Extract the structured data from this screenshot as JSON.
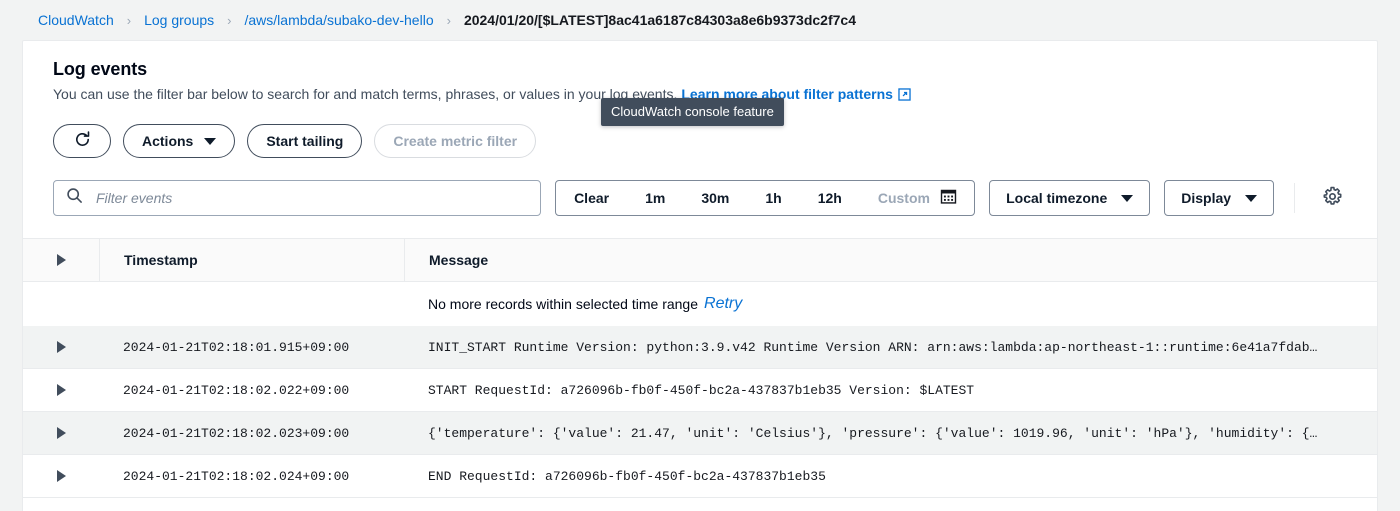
{
  "breadcrumb": {
    "items": [
      {
        "label": "CloudWatch",
        "current": false
      },
      {
        "label": "Log groups",
        "current": false
      },
      {
        "label": "/aws/lambda/subako-dev-hello",
        "current": false
      },
      {
        "label": "2024/01/20/[$LATEST]8ac41a6187c84303a8e6b9373dc2f7c4",
        "current": true
      }
    ],
    "separator": "›"
  },
  "panel": {
    "title": "Log events",
    "description": "You can use the filter bar below to search for and match terms, phrases, or values in your log events.",
    "description_link": "Learn more about filter patterns",
    "external_link_icon": "external-link-icon"
  },
  "tooltip": {
    "text": "CloudWatch console feature"
  },
  "toolbar": {
    "refresh_icon": "refresh-icon",
    "actions_label": "Actions",
    "start_tailing_label": "Start tailing",
    "create_metric_filter_label": "Create metric filter",
    "create_metric_filter_disabled": true
  },
  "filter_bar": {
    "search_placeholder": "Filter events",
    "search_value": "",
    "search_icon": "search-icon",
    "ranges": [
      {
        "label": "Clear",
        "muted": false
      },
      {
        "label": "1m",
        "muted": false
      },
      {
        "label": "30m",
        "muted": false
      },
      {
        "label": "1h",
        "muted": false
      },
      {
        "label": "12h",
        "muted": false
      },
      {
        "label": "Custom",
        "muted": true
      }
    ],
    "calendar_icon": "calendar-icon",
    "timezone_label": "Local timezone",
    "display_label": "Display",
    "settings_icon": "gear-icon"
  },
  "table": {
    "columns": [
      "Timestamp",
      "Message"
    ],
    "notice": {
      "text": "No more records within selected time range",
      "retry_label": "Retry"
    },
    "rows": [
      {
        "timestamp": "2024-01-21T02:18:01.915+09:00",
        "message": "INIT_START Runtime Version: python:3.9.v42 Runtime Version ARN: arn:aws:lambda:ap-northeast-1::runtime:6e41a7fdab…"
      },
      {
        "timestamp": "2024-01-21T02:18:02.022+09:00",
        "message": "START RequestId: a726096b-fb0f-450f-bc2a-437837b1eb35 Version: $LATEST"
      },
      {
        "timestamp": "2024-01-21T02:18:02.023+09:00",
        "message": "{'temperature': {'value': 21.47, 'unit': 'Celsius'}, 'pressure': {'value': 1019.96, 'unit': 'hPa'}, 'humidity': {…"
      },
      {
        "timestamp": "2024-01-21T02:18:02.024+09:00",
        "message": "END RequestId: a726096b-fb0f-450f-bc2a-437837b1eb35"
      }
    ]
  },
  "colors": {
    "link": "#0972d3",
    "page_background": "#f2f3f3",
    "panel_background": "#ffffff",
    "row_alt": "#f1f3f3",
    "tooltip_background": "#414d5c",
    "disabled_text": "#9ba7b6"
  }
}
